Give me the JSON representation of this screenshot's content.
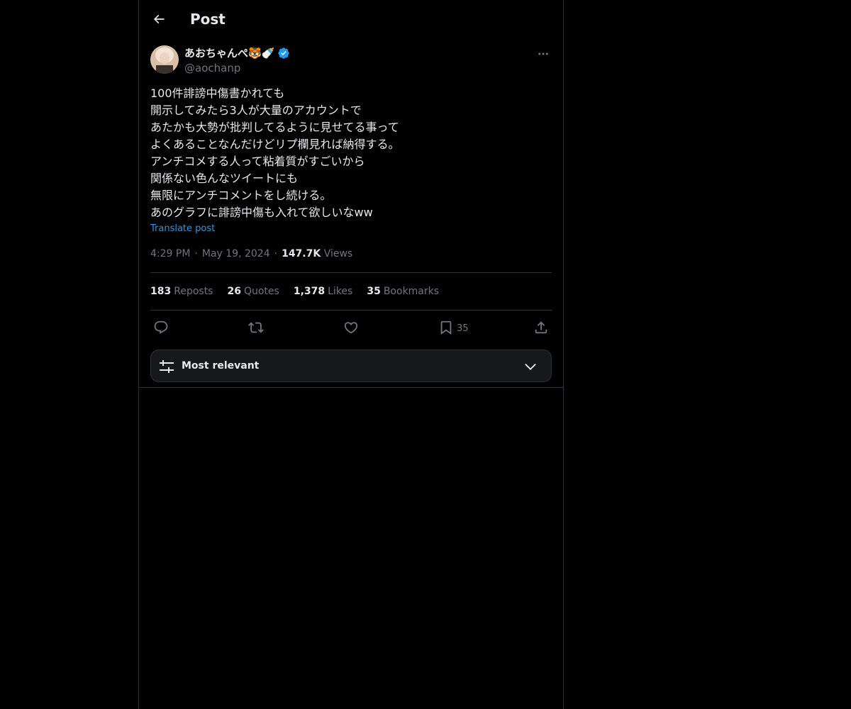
{
  "header": {
    "title": "Post"
  },
  "post": {
    "author": {
      "display_name": "あおちゃんぺ🐯🍼",
      "handle": "@aochanp",
      "verified": true
    },
    "text_lines": [
      "100件誹謗中傷書かれても",
      "開示してみたら3人が大量のアカウントで",
      "あたかも大勢が批判してるように見せてる事って",
      "よくあることなんだけどリプ欄見れば納得する。",
      "アンチコメする人って粘着質がすごいから",
      "関係ない色んなツイートにも",
      "無限にアンチコメントをし続ける。",
      "あのグラフに誹謗中傷も入れて欲しいなww"
    ],
    "translate_label": "Translate post",
    "time": "4:29 PM",
    "date": "May 19, 2024",
    "views_count": "147.7K",
    "views_label": "Views",
    "separator": "·"
  },
  "stats": {
    "reposts": {
      "count": "183",
      "label": "Reposts"
    },
    "quotes": {
      "count": "26",
      "label": "Quotes"
    },
    "likes": {
      "count": "1,378",
      "label": "Likes"
    },
    "bookmarks": {
      "count": "35",
      "label": "Bookmarks"
    }
  },
  "actions": {
    "bookmark_count": "35"
  },
  "sort": {
    "label": "Most relevant"
  },
  "colors": {
    "background": "#000000",
    "text": "#e7e9ea",
    "muted": "#71767b",
    "accent": "#1d9bf0",
    "border": "#2f3336"
  }
}
